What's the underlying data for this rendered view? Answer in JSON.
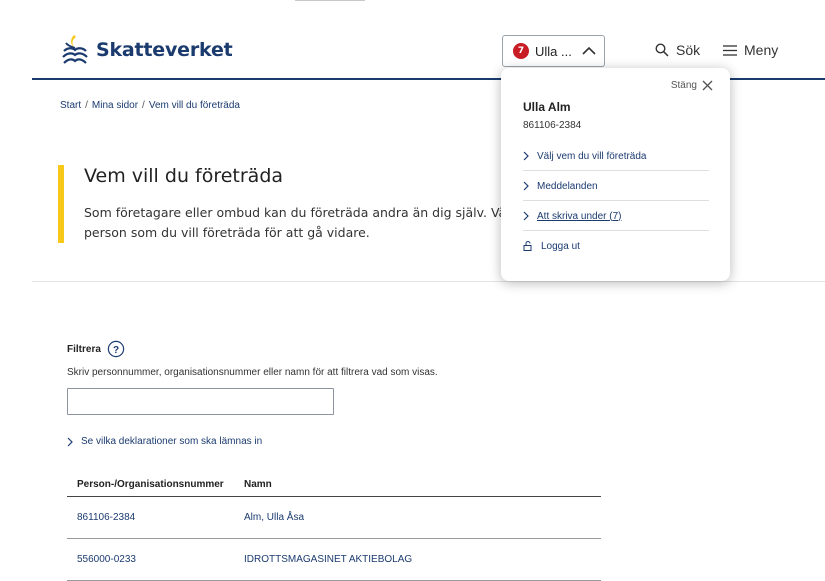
{
  "header": {
    "logo_text": "Skatteverket",
    "user_button": {
      "badge_count": "7",
      "label": "Ulla ..."
    },
    "search_label": "Sök",
    "menu_label": "Meny"
  },
  "breadcrumb": [
    "Start",
    "Mina sidor",
    "Vem vill du företräda"
  ],
  "hero": {
    "title": "Vem vill du företräda",
    "text_line1": "Som företagare eller ombud kan du företräda andra än dig själv. Vä",
    "text_line2": "person som du vill företräda för att gå vidare."
  },
  "filter": {
    "label": "Filtrera",
    "description": "Skriv personnummer, organisationsnummer eller namn för att filtrera vad som visas.",
    "value": ""
  },
  "declarations_link": "Se vilka deklarationer som ska lämnas in",
  "table": {
    "headers": [
      "Person-/Organisationsnummer",
      "Namn"
    ],
    "rows": [
      {
        "number": "861106-2384",
        "name": "Alm, Ulla Åsa"
      },
      {
        "number": "556000-0233",
        "name": "IDROTTSMAGASINET AKTIEBOLAG"
      }
    ]
  },
  "popup": {
    "close_label": "Stäng",
    "name": "Ulla Alm",
    "id": "861106-2384",
    "items": [
      {
        "label": "Välj vem du vill företräda"
      },
      {
        "label": "Meddelanden"
      },
      {
        "label": "Att skriva under (7)"
      }
    ],
    "logout_label": "Logga ut"
  },
  "colors": {
    "brand": "#1b3b6f",
    "accent_bar": "#f7c81a",
    "badge": "#c81d25"
  }
}
